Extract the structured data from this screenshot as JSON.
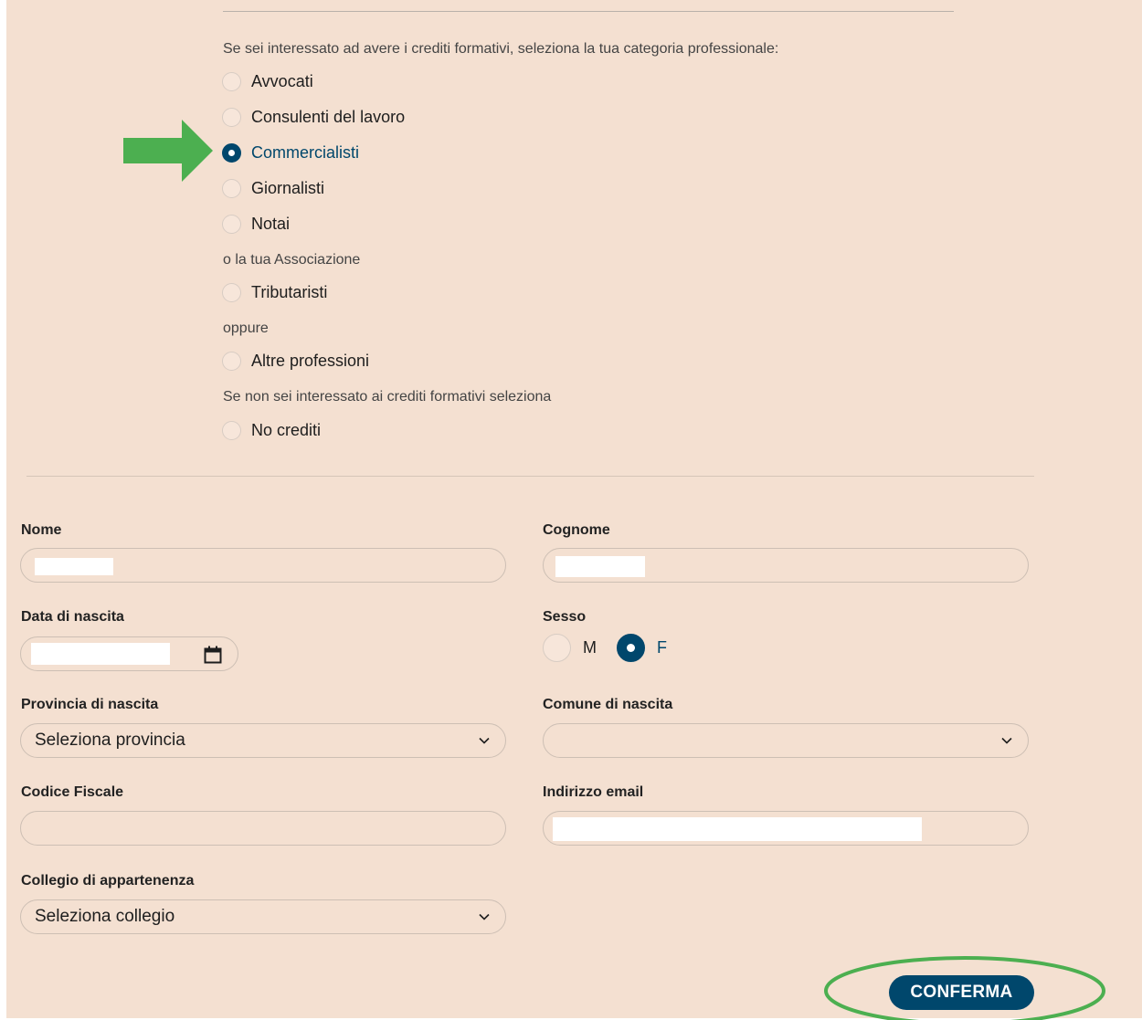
{
  "credits": {
    "intro": "Se sei interessato ad avere i crediti formativi, seleziona la tua categoria professionale:",
    "categories": [
      {
        "label": "Avvocati",
        "checked": false
      },
      {
        "label": "Consulenti del lavoro",
        "checked": false
      },
      {
        "label": "Commercialisti",
        "checked": true
      },
      {
        "label": "Giornalisti",
        "checked": false
      },
      {
        "label": "Notai",
        "checked": false
      }
    ],
    "association_note": "o la tua Associazione",
    "association_option": "Tributaristi",
    "or_note": "oppure",
    "other_option": "Altre professioni",
    "no_credit_note": "Se non sei interessato ai crediti formativi seleziona",
    "no_credit_option": "No crediti"
  },
  "form": {
    "nome_label": "Nome",
    "cognome_label": "Cognome",
    "birthdate_label": "Data di nascita",
    "sex_label": "Sesso",
    "sex_options": [
      {
        "label": "M",
        "checked": false
      },
      {
        "label": "F",
        "checked": true
      }
    ],
    "province_label": "Provincia di nascita",
    "province_value": "Seleziona provincia",
    "comune_label": "Comune di nascita",
    "comune_value": "",
    "fiscal_label": "Codice Fiscale",
    "email_label": "Indirizzo email",
    "college_label": "Collegio di appartenenza",
    "college_value": "Seleziona collegio",
    "submit_label": "CONFERMA"
  },
  "colors": {
    "background": "#f4e0d1",
    "accent": "#00476c",
    "annotation": "#4caf50"
  }
}
